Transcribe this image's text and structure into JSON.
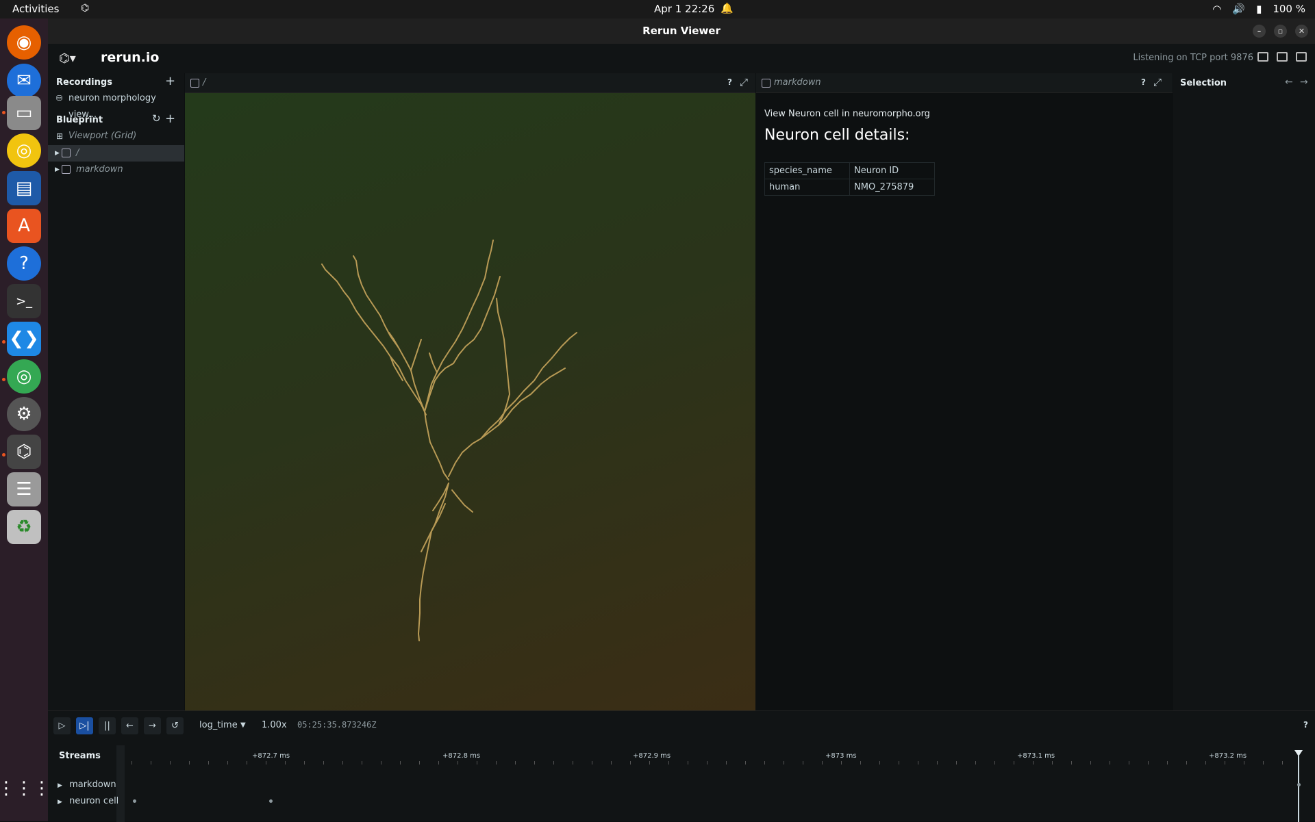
{
  "os": {
    "activities": "Activities",
    "clock": "Apr 1  22:26",
    "battery": "100 %"
  },
  "window": {
    "title": "Rerun Viewer"
  },
  "app": {
    "brand": "rerun.io",
    "status": "Listening on TCP port 9876"
  },
  "left": {
    "recordings_header": "Recordings",
    "recording_item": "neuron morphology view...",
    "blueprint_header": "Blueprint",
    "viewport": "Viewport (Grid)",
    "tree": [
      {
        "label": "/"
      },
      {
        "label": "markdown"
      }
    ]
  },
  "spatial_view": {
    "tab_label": "/",
    "help": "?",
    "expand": "⤢"
  },
  "markdown_view": {
    "tab_label": "markdown",
    "help": "?",
    "expand": "⤢",
    "link_text": "View Neuron cell in neuromorpho.org",
    "heading": "Neuron cell details:",
    "table": {
      "headers": [
        "species_name",
        "Neuron ID"
      ],
      "rows": [
        [
          "human",
          "NMO_275879"
        ]
      ]
    }
  },
  "selection_panel": {
    "title": "Selection",
    "back": "←",
    "forward": "→"
  },
  "timeline": {
    "timeline_name": "log_time",
    "speed": "1.00x",
    "current_time": "05:25:35.873246Z",
    "help": "?",
    "streams_header": "Streams",
    "ticks": [
      "+872.7 ms",
      "+872.8 ms",
      "+872.9 ms",
      "+873 ms",
      "+873.1 ms",
      "+873.2 ms"
    ],
    "streams": [
      {
        "label": "markdown"
      },
      {
        "label": "neuron cell"
      }
    ]
  },
  "colors": {
    "accent": "#1a4fa0",
    "neuron": "#b89a55"
  }
}
